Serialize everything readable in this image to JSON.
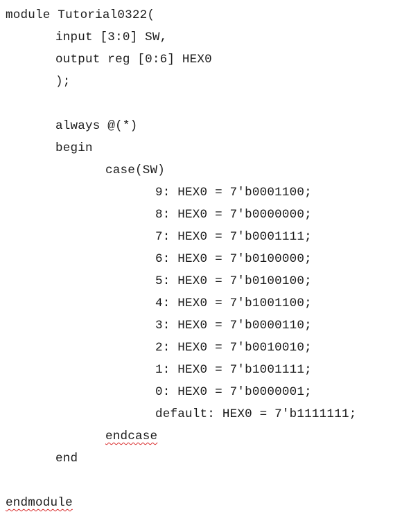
{
  "code": {
    "module_decl": "module Tutorial0322(",
    "input_decl": "input [3:0] SW,",
    "output_decl": "output reg [0:6] HEX0",
    "port_close": ");",
    "always": "always @(*)",
    "begin": "begin",
    "case_open": "case(SW)",
    "case_items": [
      "9: HEX0 = 7'b0001100;",
      "8: HEX0 = 7'b0000000;",
      "7: HEX0 = 7'b0001111;",
      "6: HEX0 = 7'b0100000;",
      "5: HEX0 = 7'b0100100;",
      "4: HEX0 = 7'b1001100;",
      "3: HEX0 = 7'b0000110;",
      "2: HEX0 = 7'b0010010;",
      "1: HEX0 = 7'b1001111;",
      "0: HEX0 = 7'b0000001;",
      "default: HEX0 = 7'b1111111;"
    ],
    "endcase": "endcase",
    "end": "end",
    "endmodule": "endmodule"
  },
  "colors": {
    "text": "#1a1a1a",
    "spellcheck_underline": "#d92b2b"
  }
}
